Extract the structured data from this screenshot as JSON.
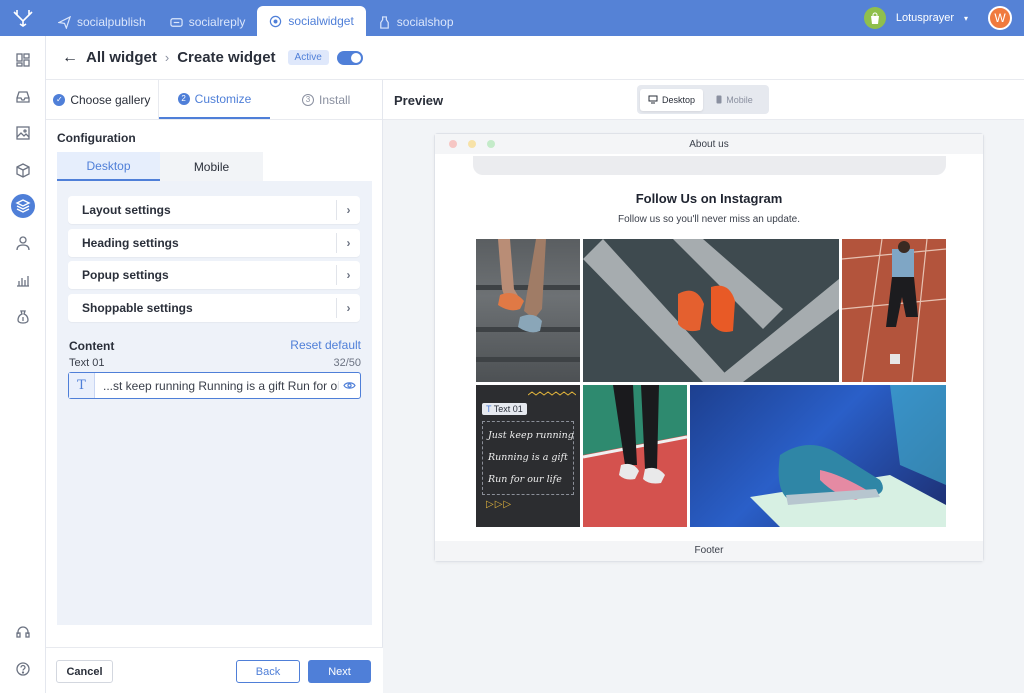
{
  "topnav": {
    "tabs": [
      {
        "label": "socialpublish",
        "icon": "paper-plane-icon"
      },
      {
        "label": "socialreply",
        "icon": "chat-icon"
      },
      {
        "label": "socialwidget",
        "icon": "widget-icon"
      },
      {
        "label": "socialshop",
        "icon": "bag-icon"
      }
    ],
    "active_tab": "socialwidget",
    "store_name": "Lotusprayer",
    "avatar_letter": "W"
  },
  "header": {
    "back_label": "All widget",
    "current_label": "Create widget",
    "status": "Active"
  },
  "steps": [
    {
      "label": "Choose gallery",
      "num": "✓"
    },
    {
      "label": "Customize",
      "num": "2"
    },
    {
      "label": "Install",
      "num": "3"
    }
  ],
  "config": {
    "title": "Configuration",
    "device_tabs": [
      "Desktop",
      "Mobile"
    ],
    "settings": [
      "Layout settings",
      "Heading settings",
      "Popup settings",
      "Shoppable settings"
    ],
    "content_title": "Content",
    "reset_label": "Reset default",
    "text_label": "Text 01",
    "text_count": "32/50",
    "text_value": "...st keep running Running is a gift Run for on"
  },
  "buttons": {
    "cancel": "Cancel",
    "back": "Back",
    "next": "Next"
  },
  "preview": {
    "title": "Preview",
    "seg_desktop": "Desktop",
    "seg_mobile": "Mobile",
    "browser_title": "About us",
    "heading": "Follow Us on Instagram",
    "subheading": "Follow us so you'll never miss an update.",
    "footer": "Footer",
    "text_tag": "Text 01",
    "quote_lines": [
      "Just keep running",
      "Running is a gift",
      "Run for our life"
    ]
  },
  "colors": {
    "brand": "#5582d6",
    "accent": "#4f7fd8"
  }
}
